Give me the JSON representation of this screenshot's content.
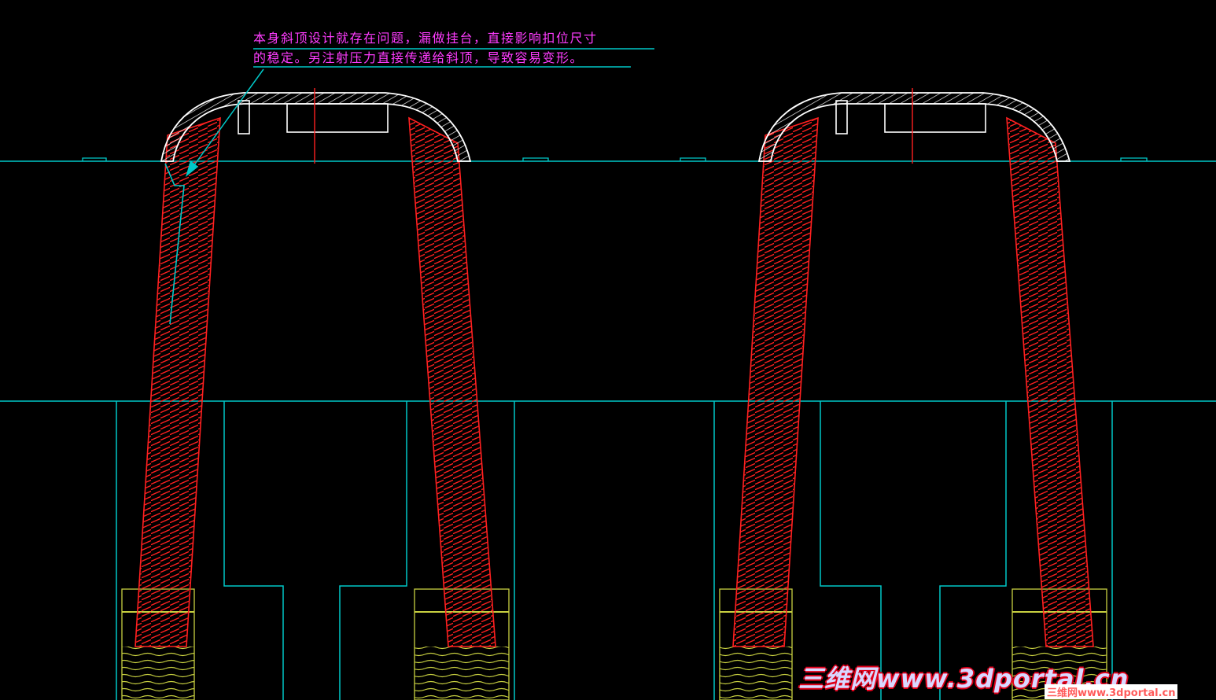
{
  "annotation": {
    "line1": "本身斜顶设计就存在问题，漏做挂台，直接影响扣位尺寸",
    "line2": "的稳定。另注射压力直接传递给斜顶，导致容易变形。"
  },
  "watermark": {
    "main": "三维网www.3dportal.cn",
    "small": "三维网www.3dportal.cn"
  },
  "colors": {
    "background": "#000000",
    "mold_lines": "#00c8c8",
    "lifter_hatch": "#ff2020",
    "part_outline": "#ffffff",
    "center_line": "#ff2020",
    "guide_block": "#c8d040",
    "annotation_text": "#ff3cff"
  }
}
